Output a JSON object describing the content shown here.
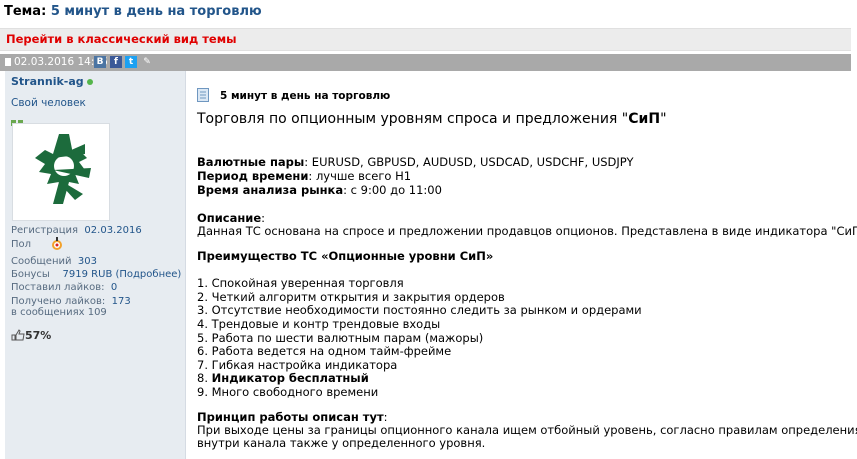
{
  "topic": {
    "prefix": "Тема:",
    "name": "5 минут в день на торговлю"
  },
  "classic_link": "Перейти в классический вид темы",
  "post": {
    "date": "02.03.2016 14:46",
    "social": [
      "В",
      "f",
      "t",
      "✎"
    ]
  },
  "user": {
    "name": "Strannik-ag",
    "rank": "Свой человек",
    "reg_label": "Регистрация",
    "reg_value": "02.03.2016",
    "gender_label": "Пол",
    "messages_label": "Сообщений",
    "messages_value": "303",
    "bonus_label": "Бонусы",
    "bonus_value": "7919 RUB (Подробнее)",
    "likes_given_label": "Поставил лайков:",
    "likes_given_value": "0",
    "likes_got_label": "Получено лайков:",
    "likes_got_value": "173",
    "likes_in_label": "в сообщениях",
    "likes_in_value": "109",
    "likes_pct": "57%",
    "icons": [
      "online-dot",
      "reputation-bars",
      "avatar-logo",
      "gender-icon",
      "likes-icon"
    ]
  },
  "content": {
    "subtitle": "5 минут в день на торговлю",
    "heading_pre": "Торговля по опционным уровням спроса и предложения \"",
    "heading_bold": "СиП",
    "heading_post": "\"",
    "pairs_label": "Валютные пары",
    "pairs_value": ": EURUSD, GBPUSD, AUDUSD, USDCAD, USDCHF, USDJPY",
    "period_label": "Период времени",
    "period_value": ": лучше всего H1",
    "analysis_label": "Время анализа рынка",
    "analysis_value": ": с 9:00 до 11:00",
    "desc_label": "Описание",
    "desc_colon": ":",
    "desc_text": "Данная ТС основана на спросе и предложении продавцов опционов. Представлена в виде индикатора \"СиП\".",
    "advantage_title": "Преимущество ТС «Опционные уровни СиП»",
    "list": [
      "1. Спокойная уверенная торговля",
      "2. Четкий алгоритм открытия и закрытия ордеров",
      "3. Отсутствие необходимости постоянно следить за рынком и ордерами",
      "4. Трендовые и контр трендовые входы",
      "5. Работа по шести валютным парам (мажоры)",
      "6. Работа ведется на одном тайм-фрейме",
      "7. Гибкая настройка индикатора"
    ],
    "item8_num": "8.",
    "item8_bold": "Индикатор бесплатный",
    "item9": "9. Много свободного времени",
    "principle_label": "Принцип работы описан тут",
    "principle_colon": ":",
    "principle_text1": "При выходе цены за границы опционного канала ищем отбойный уровень, согласно правилам определения этого",
    "principle_text2": "внутри канала также у определенного уровня."
  }
}
